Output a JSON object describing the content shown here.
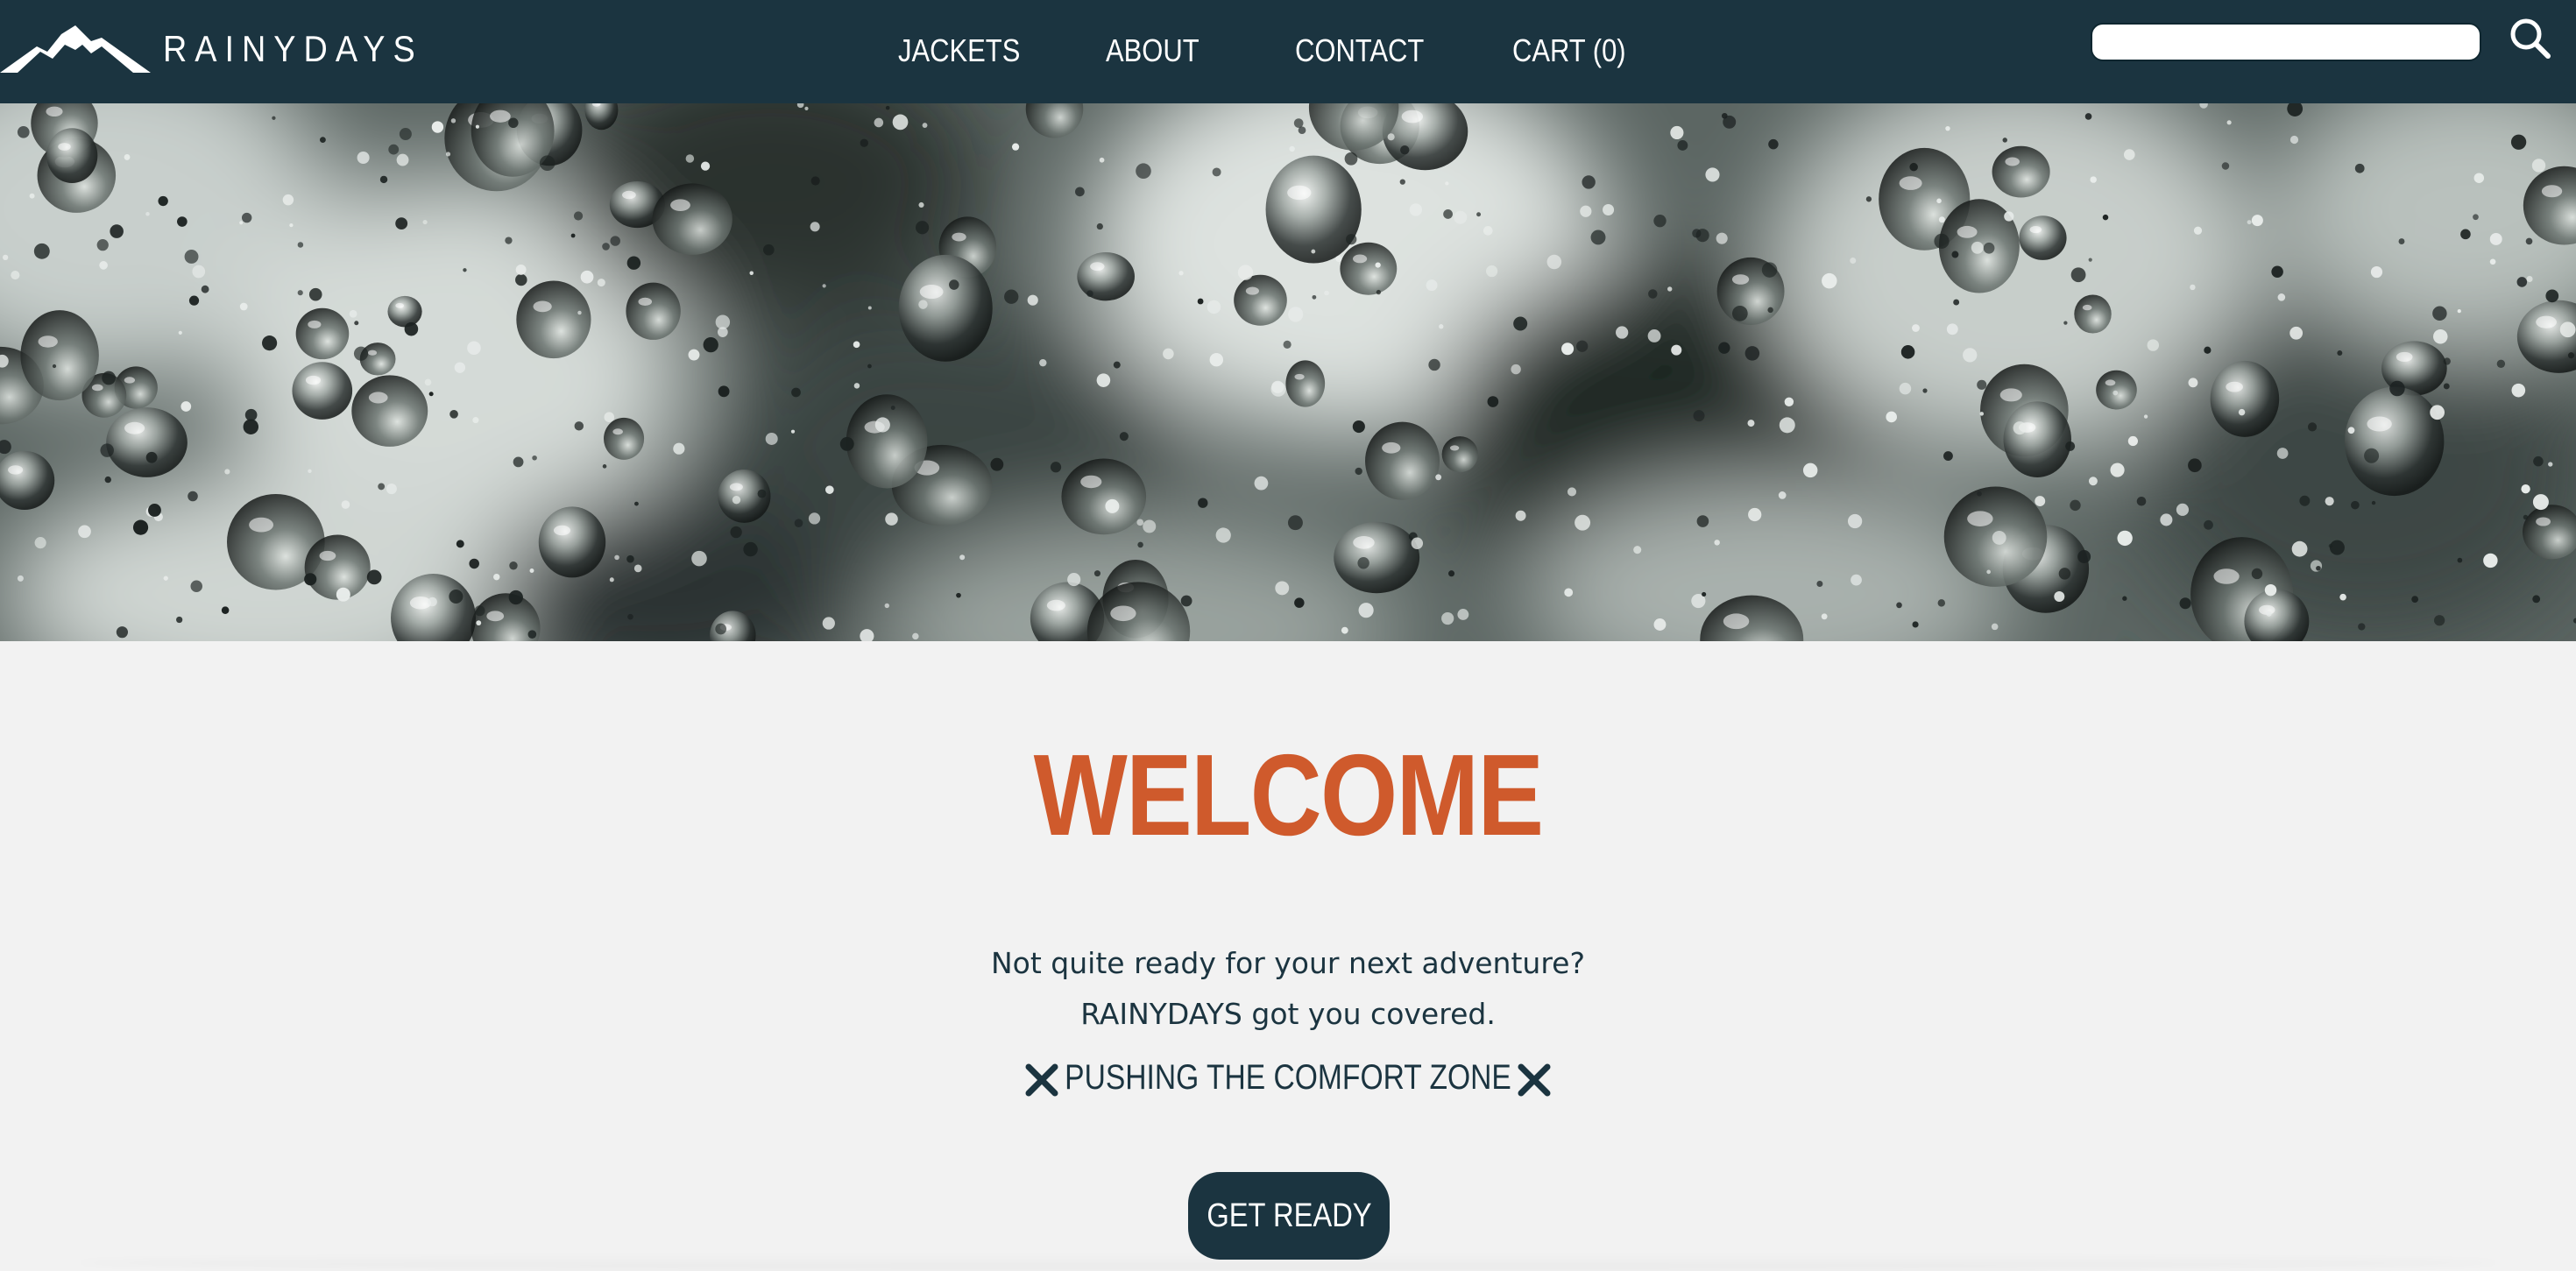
{
  "header": {
    "brand": "RAINYDAYS",
    "nav": {
      "jackets": "JACKETS",
      "about": "ABOUT",
      "contact": "CONTACT",
      "cart": "CART (0)"
    },
    "search": {
      "value": "",
      "placeholder": ""
    }
  },
  "hero": {
    "image": "raindrops-on-glass"
  },
  "main": {
    "heading": "WELCOME",
    "line1": "Not quite ready for your next adventure?",
    "line2": "RAINYDAYS got you covered.",
    "slogan": "PUSHING THE COMFORT ZONE",
    "cta": "GET READY"
  },
  "colors": {
    "header_bg": "#1b3440",
    "accent": "#cf5a2c",
    "page_bg": "#f2f2f2",
    "text": "#1b3440"
  },
  "icons": [
    "mountain-logo-icon",
    "search-icon",
    "close-x-icon"
  ]
}
